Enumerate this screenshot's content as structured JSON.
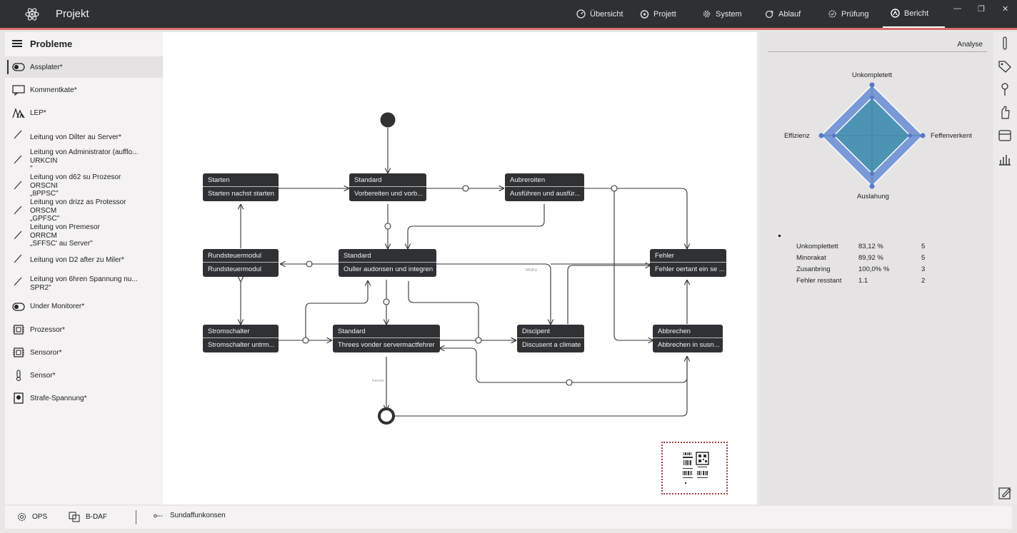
{
  "app": {
    "title": "Projekt"
  },
  "nav": {
    "tabs": [
      {
        "label": "Übersicht",
        "icon": "gauge-icon"
      },
      {
        "label": "Projett",
        "icon": "target-icon"
      },
      {
        "label": "System",
        "icon": "gear-icon"
      },
      {
        "label": "Ablauf",
        "icon": "flow-icon"
      },
      {
        "label": "Prüfung",
        "icon": "check-gear-icon"
      },
      {
        "label": "Bericht",
        "icon": "report-icon",
        "active": true
      }
    ]
  },
  "sidebar": {
    "title": "Probleme",
    "items": [
      {
        "label": "Assplater*",
        "icon": "toggle-icon"
      },
      {
        "label": "Kommentkate*",
        "icon": "comment-icon"
      },
      {
        "label": "LEP*",
        "icon": "lep-icon"
      },
      {
        "label": "Leitung von Dilter au Server*",
        "icon": "line-icon"
      },
      {
        "label": "Leitung von Administrator (aufflo...\nURKCIN\n\"",
        "icon": "line-icon"
      },
      {
        "label": "Leitung von d62 su Prozesor\nORSCNI\n„8PPSC\"",
        "icon": "line-icon"
      },
      {
        "label": "Leitung von drizz as Protessor\nORSCM\n„GPFSC\"",
        "icon": "line-icon"
      },
      {
        "label": "Leitung von Premesor\nORRCM\n„SFFSC' au Server\"",
        "icon": "line-icon"
      },
      {
        "label": "Leitung von D2 after zu Miler*",
        "icon": "line-icon"
      },
      {
        "label": "Leitung von 6hren Spannung nu...\nSPR2\"",
        "icon": "line-icon"
      },
      {
        "label": "Under Monitorer*",
        "icon": "toggle-icon"
      },
      {
        "label": "Prozessor*",
        "icon": "chip-icon"
      },
      {
        "label": "Sensoror*",
        "icon": "chip-icon"
      },
      {
        "label": "Sensor*",
        "icon": "thermometer-icon"
      },
      {
        "label": "Strafe-Spannung*",
        "icon": "square-icon"
      }
    ]
  },
  "diagram": {
    "nodes": {
      "starten": {
        "title": "Starten",
        "body": "Starten nachst starten"
      },
      "standard1": {
        "title": "Standard",
        "body": "Vorbereiten und vorb..."
      },
      "aubreroiten": {
        "title": "Aubreroiten",
        "body": "Ausführen und ausfür..."
      },
      "rundsteuer": {
        "title": "Rundsteuermodul",
        "body": "Rundsteuermodul"
      },
      "standard2": {
        "title": "Standard",
        "body": "Ouller audonsen und integren"
      },
      "fehler": {
        "title": "Fehler",
        "body": "Fehler oertant ein se ..."
      },
      "stromschalter": {
        "title": "Stromschalter",
        "body": "Stromschalter untrm..."
      },
      "standard3": {
        "title": "Standard",
        "body": "Threes vonder servermactfehrer"
      },
      "discipent": {
        "title": "Discipent",
        "body": "Discusent a climate"
      },
      "abbrechen": {
        "title": "Abbrechen",
        "body": "Abbrechen in susn..."
      }
    },
    "edge_labels": {
      "mid": "MOKU",
      "low": "Fenchi"
    }
  },
  "analyse": {
    "title": "Analyse",
    "radar": {
      "axes": [
        "Unkompletett",
        "Feffenverkent",
        "Auslahung",
        "Effizienz"
      ],
      "outer": [
        1.0,
        1.0,
        1.0,
        1.0
      ],
      "inner": [
        0.75,
        0.75,
        0.75,
        0.75
      ],
      "colors": {
        "outer": "#7b99d6",
        "inner": "#4d93b3",
        "point": "#5878c8"
      }
    },
    "stats": [
      {
        "name": "Unkomplettett",
        "value": "83,12 %",
        "count": "5"
      },
      {
        "name": "Minorakat",
        "value": "89,92 %",
        "count": "5"
      },
      {
        "name": "Zusanbring",
        "value": "100,0% %",
        "count": "3"
      },
      {
        "name": "Fehler resstant",
        "value": "1.1",
        "count": "2"
      }
    ]
  },
  "bottombar": {
    "items": [
      {
        "label": "OPS",
        "icon": "gear-icon"
      },
      {
        "label": "B-DAF",
        "icon": "copy-icon"
      },
      {
        "label": "Sundaffunkonsen",
        "icon": "link-icon"
      }
    ]
  }
}
